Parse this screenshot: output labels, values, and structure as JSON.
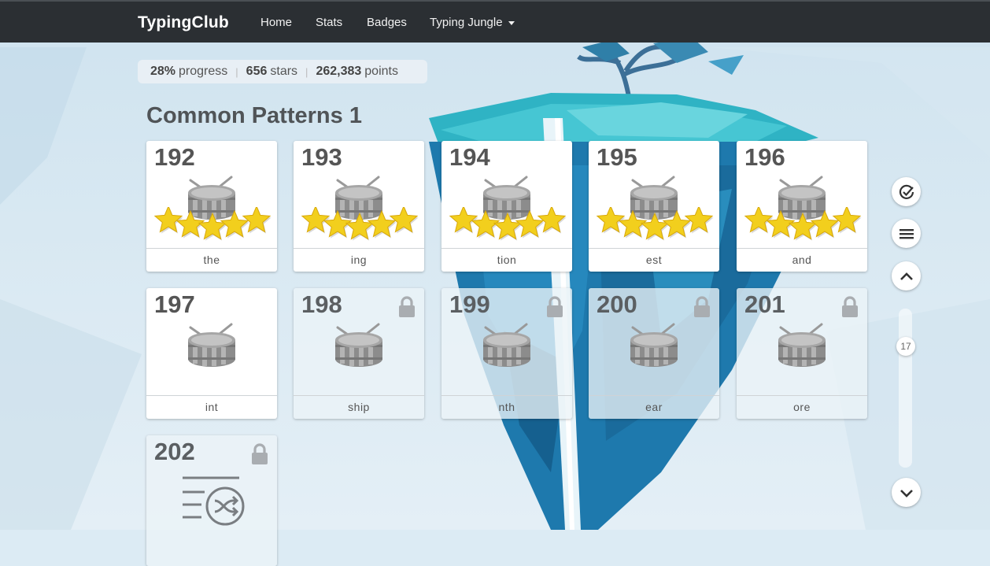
{
  "nav": {
    "brand": "TypingClub",
    "items": [
      "Home",
      "Stats",
      "Badges",
      "Typing Jungle"
    ]
  },
  "progress": {
    "percent": "28%",
    "percent_label": "progress",
    "stars": "656",
    "stars_label": "stars",
    "points": "262,383",
    "points_label": "points"
  },
  "section": {
    "title": "Common Patterns 1"
  },
  "lessons": [
    {
      "number": "192",
      "word": "the",
      "stars": 5,
      "locked": false
    },
    {
      "number": "193",
      "word": "ing",
      "stars": 5,
      "locked": false
    },
    {
      "number": "194",
      "word": "tion",
      "stars": 5,
      "locked": false
    },
    {
      "number": "195",
      "word": "est",
      "stars": 5,
      "locked": false
    },
    {
      "number": "196",
      "word": "and",
      "stars": 5,
      "locked": false
    },
    {
      "number": "197",
      "word": "int",
      "stars": 0,
      "locked": false
    },
    {
      "number": "198",
      "word": "ship",
      "stars": 0,
      "locked": true
    },
    {
      "number": "199",
      "word": "nth",
      "stars": 0,
      "locked": true
    },
    {
      "number": "200",
      "word": "ear",
      "stars": 0,
      "locked": true
    },
    {
      "number": "201",
      "word": "ore",
      "stars": 0,
      "locked": true
    },
    {
      "number": "202",
      "word": "",
      "stars": 0,
      "locked": true
    }
  ],
  "side_controls": {
    "icons": [
      "check-circle-icon",
      "menu-icon",
      "chevron-up-icon",
      "chevron-down-icon"
    ],
    "scroll_position": "17"
  },
  "colors": {
    "nav_bg": "#2b2f33",
    "star": "#f2cf1d",
    "card_text": "#555555"
  }
}
